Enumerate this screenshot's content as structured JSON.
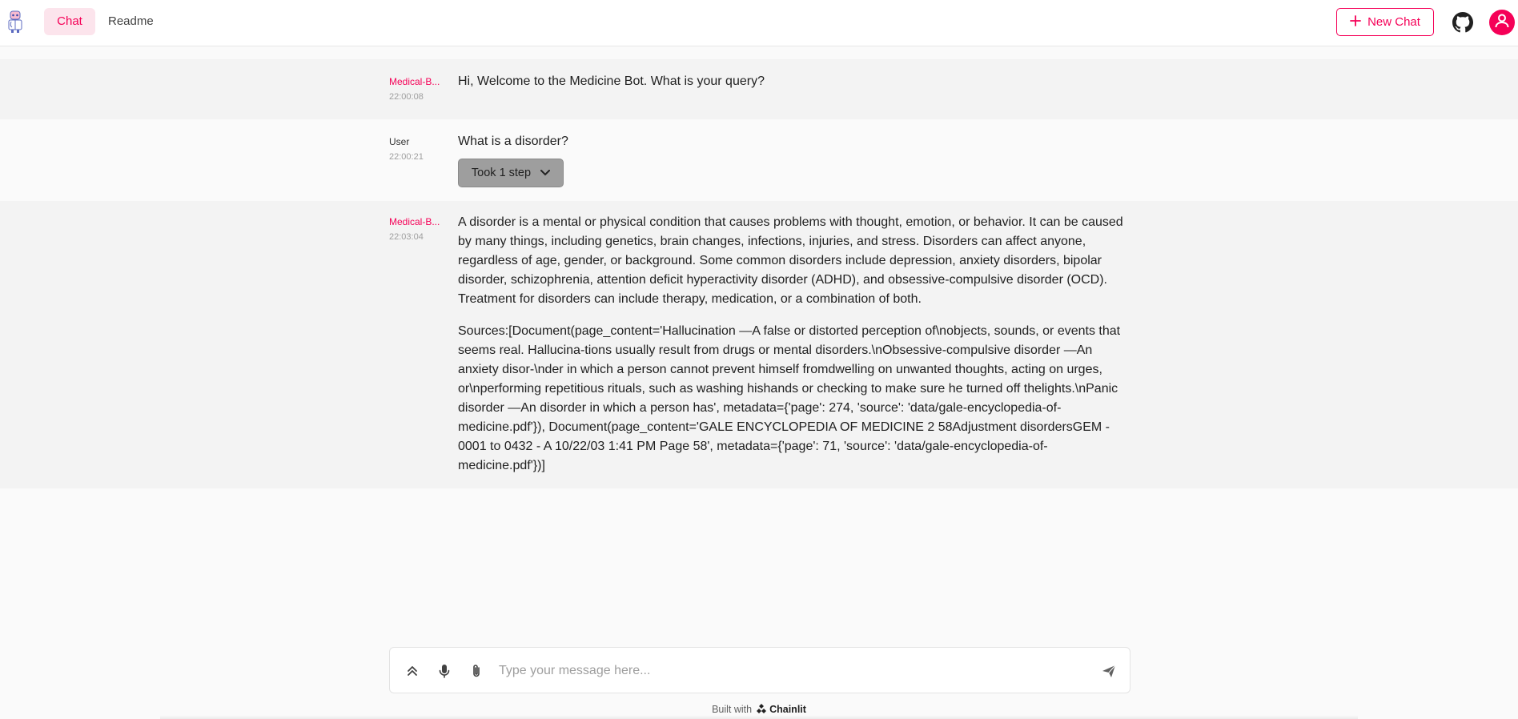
{
  "header": {
    "tabs": [
      {
        "label": "Chat",
        "active": true
      },
      {
        "label": "Readme",
        "active": false
      }
    ],
    "new_chat_label": "New Chat",
    "icons": {
      "logo": "doctor-robot-icon",
      "github": "github-icon",
      "account": "user-icon",
      "plus": "plus-icon"
    }
  },
  "messages": [
    {
      "author": "Medical-B...",
      "time": "22:00:08",
      "text": "Hi, Welcome to the Medicine Bot. What is your query?"
    },
    {
      "author": "User",
      "time": "22:00:21",
      "text": "What is a disorder?",
      "step_label": "Took 1 step"
    },
    {
      "author": "Medical-B...",
      "time": "22:03:04",
      "text": "A disorder is a mental or physical condition that causes problems with thought, emotion, or behavior. It can be caused by many things, including genetics, brain changes, infections, injuries, and stress. Disorders can affect anyone, regardless of age, gender, or background. Some common disorders include depression, anxiety disorders, bipolar disorder, schizophrenia, attention deficit hyperactivity disorder (ADHD), and obsessive-compulsive disorder (OCD). Treatment for disorders can include therapy, medication, or a combination of both.",
      "sources": "Sources:[Document(page_content='Hallucination —A false or distorted perception of\\nobjects, sounds, or events that seems real. Hallucina-tions usually result from drugs or mental disorders.\\nObsessive-compulsive disorder —An anxiety disor-\\nder in which a person cannot prevent himself fromdwelling on unwanted thoughts, acting on urges, or\\nperforming repetitious rituals, such as washing hishands or checking to make sure he turned off thelights.\\nPanic disorder —An disorder in which a person has', metadata={'page': 274, 'source': 'data/gale-encyclopedia-of-medicine.pdf'}), Document(page_content='GALE ENCYCLOPEDIA OF MEDICINE 2 58Adjustment disordersGEM - 0001 to 0432 - A  10/22/03 1:41 PM  Page 58', metadata={'page': 71, 'source': 'data/gale-encyclopedia-of-medicine.pdf'})]"
    }
  ],
  "composer": {
    "placeholder": "Type your message here...",
    "icons": [
      "expand-up-icon",
      "microphone-icon",
      "paperclip-icon",
      "send-icon"
    ]
  },
  "footer": {
    "built_with": "Built with",
    "brand": "Chainlit"
  },
  "colors": {
    "accent": "#f50057",
    "accent_light": "#fce4ec",
    "bot_row_bg": "#f3f3f3",
    "page_bg": "#fafafa"
  }
}
